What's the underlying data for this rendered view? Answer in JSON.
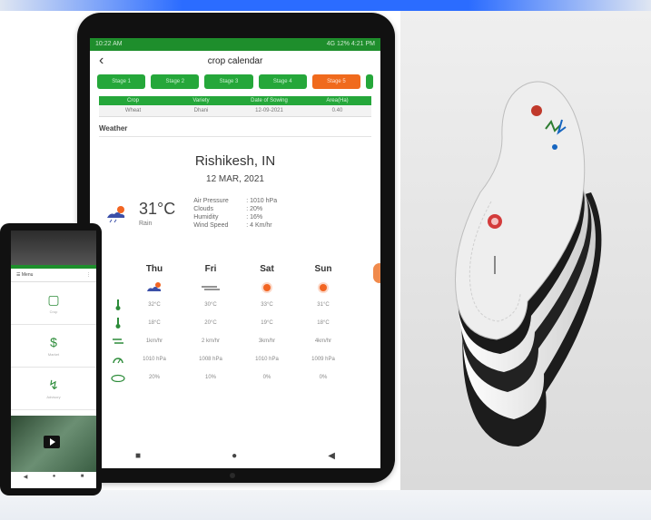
{
  "tablet": {
    "statusbar": {
      "left": "10:22 AM",
      "right": "4G 12% 4:21 PM"
    },
    "appbar": {
      "back_glyph": "‹",
      "title": "crop calendar"
    },
    "tabs": [
      "Stage 1",
      "Stage 2",
      "Stage 3",
      "Stage 4",
      "Stage 5"
    ],
    "active_tab_index": 4,
    "table": {
      "headers": [
        "Crop",
        "Variety",
        "Date of Sowing",
        "Area(Ha)"
      ],
      "rows": [
        [
          "Wheat",
          "Dhani",
          "12-09-2021",
          "0.40"
        ]
      ]
    },
    "weather_section": "Weather",
    "location": "Rishikesh, IN",
    "date": "12 MAR, 2021",
    "current": {
      "temp": "31°C",
      "condition": "Rain",
      "details": [
        {
          "k": "Air Pressure",
          "v": ": 1010 hPa"
        },
        {
          "k": "Clouds",
          "v": ": 20%"
        },
        {
          "k": "Humidity",
          "v": ": 16%"
        },
        {
          "k": "Wind Speed",
          "v": ": 4 Km/hr"
        }
      ]
    },
    "forecast": {
      "days": [
        "Thu",
        "Fri",
        "Sat",
        "Sun"
      ],
      "rows": [
        [
          "32°C",
          "30°C",
          "33°C",
          "31°C"
        ],
        [
          "18°C",
          "20°C",
          "19°C",
          "18°C"
        ],
        [
          "1km/hr",
          "2 km/hr",
          "3km/hr",
          "4km/hr"
        ],
        [
          "1010 hPa",
          "1008 hPa",
          "1010 hPa",
          "1009 hPa"
        ],
        [
          "20%",
          "10%",
          "0%",
          "0%"
        ]
      ]
    },
    "navbar": [
      "■",
      "●",
      "◀"
    ],
    "colors": {
      "green": "#25a73a",
      "orange": "#f06a1d"
    }
  },
  "phone": {
    "header_left": "☰ Menu",
    "header_right": "⋮",
    "items": [
      {
        "glyph": "▢",
        "caption": "Crop"
      },
      {
        "glyph": "$",
        "caption": "Market"
      },
      {
        "glyph": "↯",
        "caption": "Advisory"
      }
    ],
    "nav": [
      "◀",
      "●",
      "■"
    ]
  },
  "photo": {
    "subject": "insole-stack"
  }
}
